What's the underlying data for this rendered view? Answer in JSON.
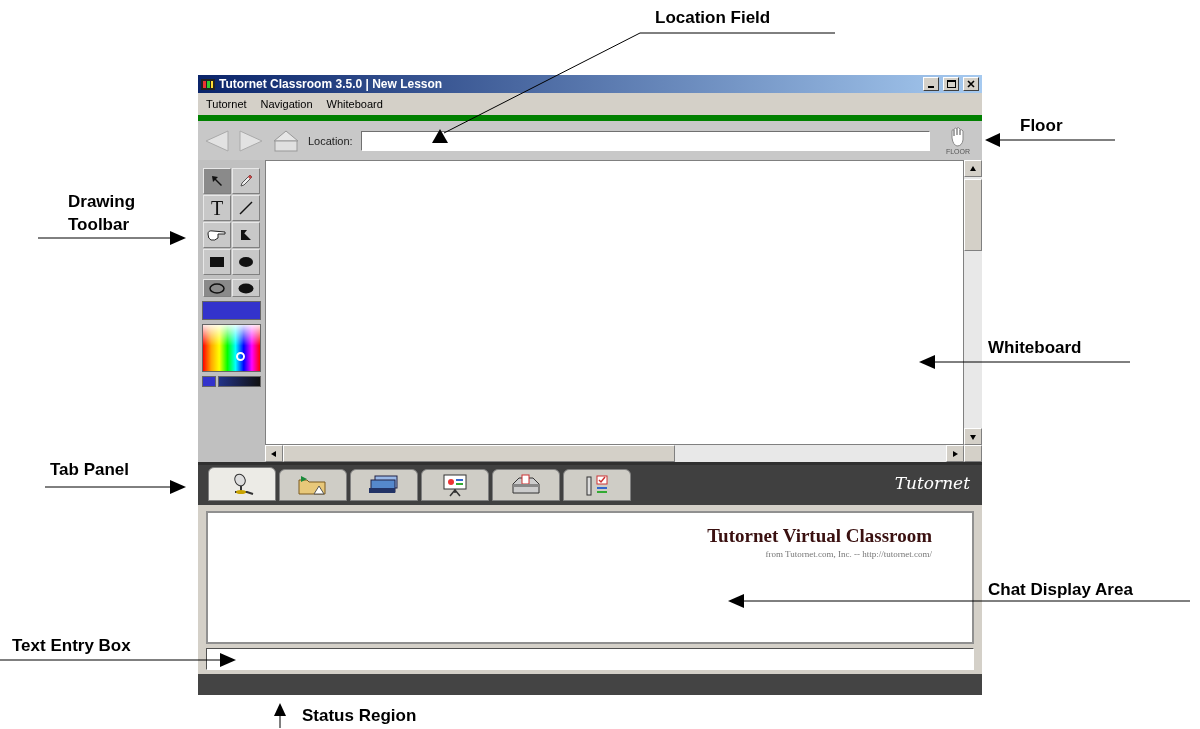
{
  "window": {
    "title": "Tutornet Classroom 3.5.0 | New Lesson"
  },
  "menu": [
    "Tutornet",
    "Navigation",
    "Whiteboard"
  ],
  "navigation": {
    "location_label": "Location:",
    "floor_label": "FLOOR"
  },
  "drawing_tools": [
    {
      "kind": "pointer",
      "selected": true
    },
    {
      "kind": "pencil",
      "selected": false
    },
    {
      "kind": "text",
      "glyph": "T",
      "selected": false
    },
    {
      "kind": "line",
      "selected": false
    },
    {
      "kind": "hand",
      "selected": false
    },
    {
      "kind": "flag",
      "selected": false
    },
    {
      "kind": "rectangle",
      "selected": false
    },
    {
      "kind": "ellipse",
      "selected": false
    }
  ],
  "fill_modes": [
    {
      "kind": "outline",
      "selected": true
    },
    {
      "kind": "filled",
      "selected": false
    }
  ],
  "tabs": [
    {
      "kind": "microphone",
      "selected": true
    },
    {
      "kind": "folder",
      "selected": false
    },
    {
      "kind": "files",
      "selected": false
    },
    {
      "kind": "presentation",
      "selected": false
    },
    {
      "kind": "inbox",
      "selected": false
    },
    {
      "kind": "quiz",
      "selected": false
    }
  ],
  "logo": "Tutornet",
  "chat": {
    "heading": "Tutornet Virtual Classroom",
    "subtitle": "from Tutornet.com, Inc. -- http://tutornet.com/"
  },
  "annotations": [
    "Location Field",
    "Floor",
    "Drawing Toolbar",
    "Whiteboard",
    "Tab Panel",
    "Chat Display Area",
    "Text Entry Box",
    "Status Region"
  ]
}
